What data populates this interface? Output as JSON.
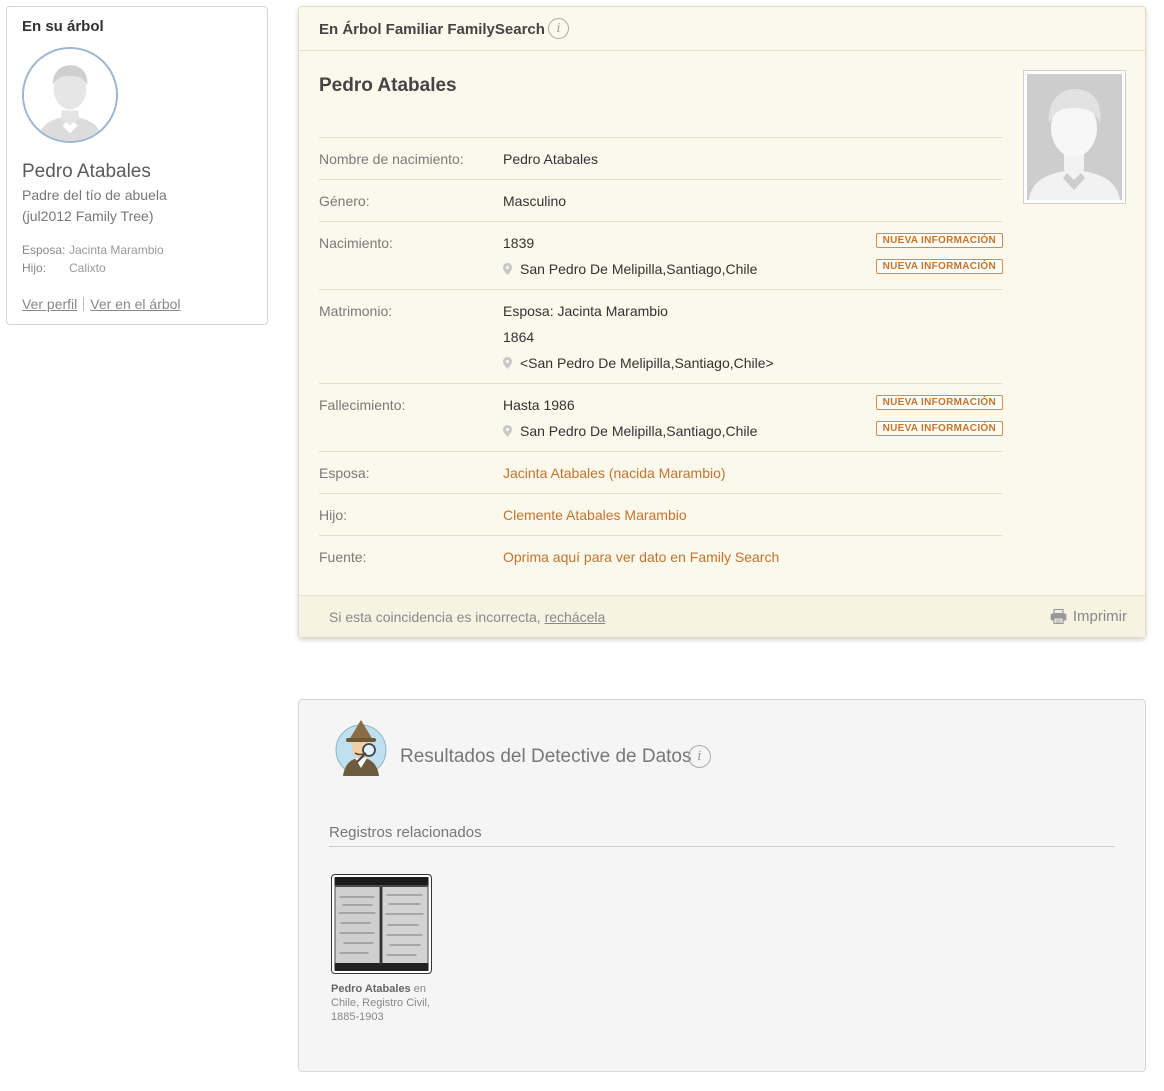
{
  "left_card": {
    "title": "En su árbol",
    "name": "Pedro Atabales",
    "relationship": "Padre del tío de abuela",
    "source": "(jul2012 Family Tree)",
    "family": [
      {
        "label": "Esposa:",
        "value": "Jacinta Marambio"
      },
      {
        "label": "Hijo:",
        "value": "Calixto"
      }
    ],
    "links": {
      "profile": "Ver perfil",
      "tree": "Ver en el árbol"
    }
  },
  "main_card": {
    "header_title": "En Árbol Familiar FamilySearch",
    "info_icon": "i",
    "person_name": "Pedro Atabales",
    "rows": {
      "birth_name": {
        "label": "Nombre de nacimiento:",
        "value": "Pedro Atabales"
      },
      "gender": {
        "label": "Género:",
        "value": "Masculino"
      },
      "birth": {
        "label": "Nacimiento:",
        "date": "1839",
        "place": "San Pedro De Melipilla,Santiago,Chile"
      },
      "marriage": {
        "label": "Matrimonio:",
        "spouse": "Esposa: Jacinta Marambio",
        "date": "1864",
        "place": "<San Pedro De Melipilla,Santiago,Chile>"
      },
      "death": {
        "label": "Fallecimiento:",
        "date": "Hasta 1986",
        "place": "San Pedro De Melipilla,Santiago,Chile"
      },
      "spouse": {
        "label": "Esposa:",
        "value": "Jacinta Atabales (nacida Marambio)"
      },
      "child": {
        "label": "Hijo:",
        "value": "Clemente Atabales Marambio"
      },
      "source": {
        "label": "Fuente:",
        "value": "Oprima aquí para ver dato en Family Search"
      }
    },
    "badge_text": "NUEVA INFORMACIÓN",
    "footer": {
      "message": "Si esta coincidencia es incorrecta,",
      "reject_link": "rechácela",
      "print_label": "Imprimir"
    }
  },
  "detective_card": {
    "title": "Resultados del Detective de Datos",
    "info_icon": "i",
    "subtitle": "Registros relacionados",
    "record": {
      "name": "Pedro Atabales",
      "text_after_name": "en",
      "collection": "Chile, Registro Civil, 1885-1903"
    }
  },
  "colors": {
    "accent_link": "#c5742e",
    "main_card_bg": "#fbf8ec",
    "avatar_ring": "#9bb6cf"
  },
  "icons": [
    "avatar-silhouette-icon",
    "info-icon",
    "location-pin-icon",
    "printer-icon",
    "detective-icon"
  ]
}
